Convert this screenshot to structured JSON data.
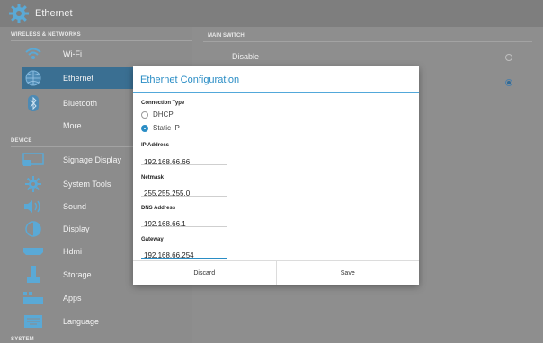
{
  "topbar": {
    "title": "Ethernet",
    "icon": "gear-icon"
  },
  "left": {
    "sections": [
      {
        "header": "WIRELESS & NETWORKS"
      },
      {
        "header": "DEVICE"
      },
      {
        "header": "SYSTEM"
      }
    ],
    "items": [
      {
        "label": "Wi-Fi",
        "icon": "wifi-icon"
      },
      {
        "label": "Ethernet",
        "icon": "globe-icon",
        "selected": true
      },
      {
        "label": "Bluetooth",
        "icon": "bluetooth-icon"
      },
      {
        "label": "More...",
        "icon": ""
      },
      {
        "label": "Signage Display",
        "icon": "display-icon"
      },
      {
        "label": "System Tools",
        "icon": "gear-icon"
      },
      {
        "label": "Sound",
        "icon": "speaker-icon"
      },
      {
        "label": "Display",
        "icon": "brightness-icon"
      },
      {
        "label": "Hdmi",
        "icon": "hdmi-icon"
      },
      {
        "label": "Storage",
        "icon": "storage-icon"
      },
      {
        "label": "Apps",
        "icon": "apps-icon"
      },
      {
        "label": "Language",
        "icon": "keyboard-icon"
      }
    ]
  },
  "main": {
    "header": "MAIN SWITCH",
    "option": "Disable"
  },
  "dialog": {
    "title": "Ethernet Configuration",
    "connection_type_label": "Connection Type",
    "options": [
      "DHCP",
      "Static IP"
    ],
    "selected_option": "Static IP",
    "ip_label": "IP Address",
    "ip_value": "192.168.66.66",
    "netmask_label": "Netmask",
    "netmask_value": "255.255.255.0",
    "dns_label": "DNS Address",
    "dns_value": "192.168.66.1",
    "gateway_label": "Gateway",
    "gateway_value": "192.168.66.254",
    "discard": "Discard",
    "save": "Save"
  },
  "colors": {
    "accent": "#2a8dc5",
    "selected_bg": "#3a6f92"
  }
}
